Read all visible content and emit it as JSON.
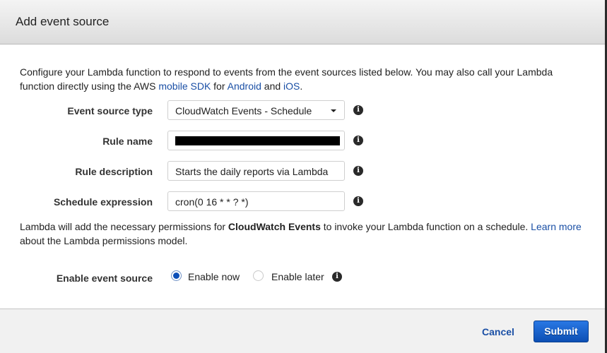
{
  "dialog": {
    "title": "Add event source"
  },
  "intro": {
    "text_before": "Configure your Lambda function to respond to events from the event sources listed below. You may also call your Lambda function directly using the AWS ",
    "link_mobile_sdk": "mobile SDK",
    "text_for": " for ",
    "link_android": "Android",
    "text_and": " and ",
    "link_ios": "iOS",
    "text_end": "."
  },
  "form": {
    "event_source_type": {
      "label": "Event source type",
      "selected": "CloudWatch Events - Schedule",
      "icon": "info-icon"
    },
    "rule_name": {
      "label": "Rule name",
      "value": "[redacted]",
      "icon": "info-icon"
    },
    "rule_description": {
      "label": "Rule description",
      "value": "Starts the daily reports via Lambda",
      "icon": "info-icon"
    },
    "schedule_expression": {
      "label": "Schedule expression",
      "value": "cron(0 16 * * ? *)",
      "icon": "info-icon"
    }
  },
  "permissions": {
    "text_before": "Lambda will add the necessary permissions for ",
    "bold": "CloudWatch Events",
    "text_after": " to invoke your Lambda function on a schedule. ",
    "link": "Learn more",
    "text_end": " about the Lambda permissions model."
  },
  "enable": {
    "label": "Enable event source",
    "options": [
      {
        "label": "Enable now",
        "checked": true
      },
      {
        "label": "Enable later",
        "checked": false
      }
    ],
    "icon": "info-icon"
  },
  "footer": {
    "cancel_label": "Cancel",
    "submit_label": "Submit"
  },
  "colors": {
    "link": "#1a4fa5",
    "primary_button": "#0d4fb4",
    "radio_checked": "#0c4fb8"
  }
}
